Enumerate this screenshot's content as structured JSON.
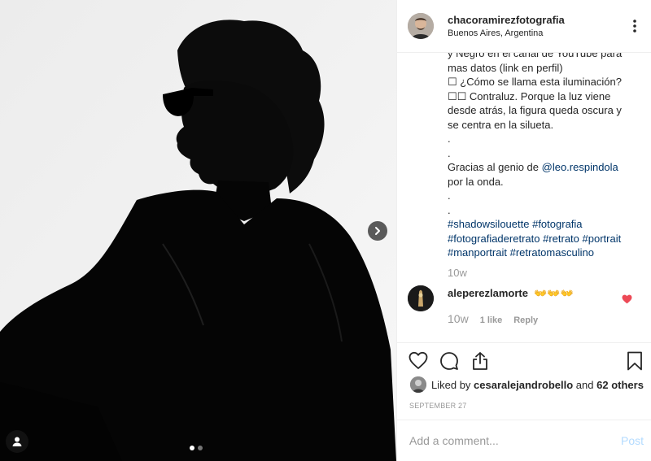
{
  "post": {
    "username": "chacoramirezfotografia",
    "location": "Buenos Aires, Argentina",
    "more_icon": "more-options-icon"
  },
  "caption": {
    "lines": [
      "y Negro en el canal de YouTube para",
      "mas datos (link en perfil)",
      "☐ ¿Cómo se llama esta iluminación?",
      "☐☐ Contraluz. Porque la luz viene",
      "desde atrás, la figura queda oscura y",
      "se centra en la silueta.",
      ".",
      ".",
      "Gracias al genio de ",
      "por la onda.",
      ".",
      "."
    ],
    "mention": "@leo.respindola",
    "hashtags_line1": [
      "#shadowsilouette",
      "#fotografia"
    ],
    "hashtags_line2": [
      "#fotografiaderetrato",
      "#retrato",
      "#portrait"
    ],
    "hashtags_line3": [
      "#manportrait",
      "#retratomasculino"
    ],
    "time": "10w"
  },
  "comment": {
    "username": "aleperezlamorte",
    "text": "👐👐👐",
    "time": "10w",
    "likes": "1 like",
    "reply": "Reply",
    "liked_color": "#ed4956"
  },
  "likes": {
    "prefix": "Liked by ",
    "user": "cesaralejandrobello",
    "suffix": " and ",
    "others": "62 others"
  },
  "date": "SEPTEMBER 27",
  "add_comment": {
    "placeholder": "Add a comment...",
    "post_label": "Post"
  },
  "carousel": {
    "current": 1,
    "total": 2
  },
  "colors": {
    "link": "#003569",
    "muted": "#999999",
    "border": "#efefef",
    "post_disabled": "#b3dbff"
  }
}
